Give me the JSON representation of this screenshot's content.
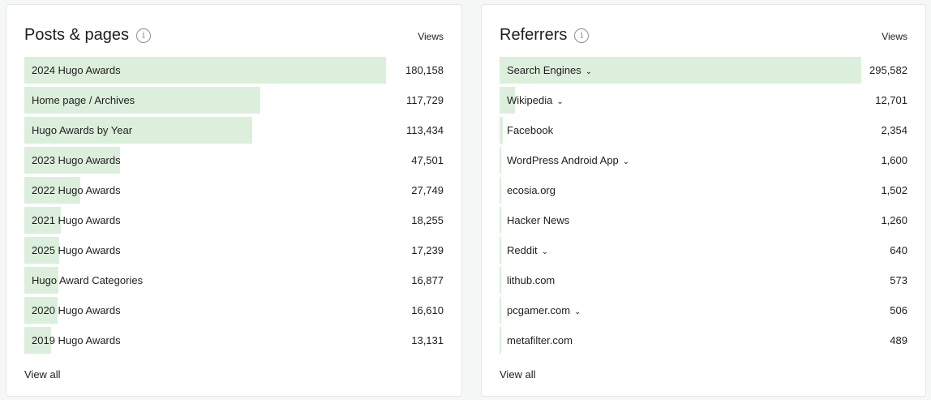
{
  "posts": {
    "title": "Posts & pages",
    "info_icon": "info-icon",
    "column_label": "Views",
    "view_all": "View all",
    "max": 180158,
    "rows": [
      {
        "label": "2024 Hugo Awards",
        "value": "180,158",
        "views": 180158
      },
      {
        "label": "Home page / Archives",
        "value": "117,729",
        "views": 117729
      },
      {
        "label": "Hugo Awards by Year",
        "value": "113,434",
        "views": 113434
      },
      {
        "label": "2023 Hugo Awards",
        "value": "47,501",
        "views": 47501
      },
      {
        "label": "2022 Hugo Awards",
        "value": "27,749",
        "views": 27749
      },
      {
        "label": "2021 Hugo Awards",
        "value": "18,255",
        "views": 18255
      },
      {
        "label": "2025 Hugo Awards",
        "value": "17,239",
        "views": 17239
      },
      {
        "label": "Hugo Award Categories",
        "value": "16,877",
        "views": 16877
      },
      {
        "label": "2020 Hugo Awards",
        "value": "16,610",
        "views": 16610
      },
      {
        "label": "2019 Hugo Awards",
        "value": "13,131",
        "views": 13131
      }
    ]
  },
  "referrers": {
    "title": "Referrers",
    "info_icon": "info-icon",
    "column_label": "Views",
    "view_all": "View all",
    "max": 295582,
    "rows": [
      {
        "label": "Search Engines",
        "value": "295,582",
        "views": 295582,
        "expandable": true
      },
      {
        "label": "Wikipedia",
        "value": "12,701",
        "views": 12701,
        "expandable": true
      },
      {
        "label": "Facebook",
        "value": "2,354",
        "views": 2354,
        "expandable": false
      },
      {
        "label": "WordPress Android App",
        "value": "1,600",
        "views": 1600,
        "expandable": true
      },
      {
        "label": "ecosia.org",
        "value": "1,502",
        "views": 1502,
        "expandable": false
      },
      {
        "label": "Hacker News",
        "value": "1,260",
        "views": 1260,
        "expandable": false
      },
      {
        "label": "Reddit",
        "value": "640",
        "views": 640,
        "expandable": true
      },
      {
        "label": "lithub.com",
        "value": "573",
        "views": 573,
        "expandable": false
      },
      {
        "label": "pcgamer.com",
        "value": "506",
        "views": 506,
        "expandable": true
      },
      {
        "label": "metafilter.com",
        "value": "489",
        "views": 489,
        "expandable": false
      }
    ]
  },
  "colors": {
    "bar": "#dcefdc",
    "card": "#ffffff",
    "background": "#f6f7f7"
  }
}
